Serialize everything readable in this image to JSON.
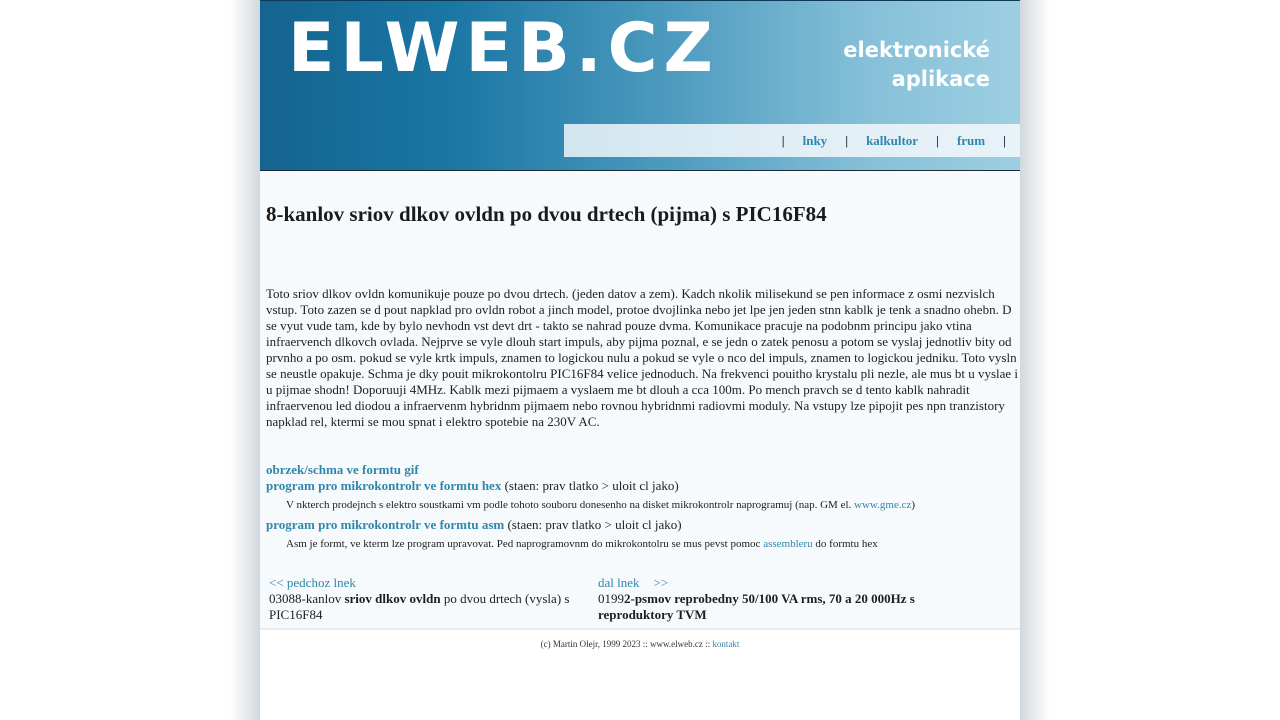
{
  "header": {
    "logo": "ELWEB.CZ",
    "tagline_line1": "elektronické",
    "tagline_line2": "aplikace"
  },
  "nav": {
    "separator": "|",
    "items": [
      {
        "label": "lnky"
      },
      {
        "label": "kalkultor"
      },
      {
        "label": "frum"
      }
    ]
  },
  "article": {
    "title": "8-kanlov sriov dlkov ovldn po dvou drtech (pijma) s PIC16F84",
    "body": "Toto sriov dlkov ovldn komunikuje pouze po dvou drtech. (jeden datov a zem). Kadch nkolik milisekund se pen informace z osmi nezvislch vstup. Toto zazen se d pout napklad pro ovldn robot a jinch model, protoe dvojlinka nebo jet lpe jen jeden stnn kablk je tenk a snadno ohebn. D se vyut vude tam, kde by bylo nevhodn vst devt drt - takto se nahrad pouze dvma. Komunikace pracuje na podobnm principu jako vtina infraervench dlkovch ovlada. Nejprve se vyle dlouh start impuls, aby pijma poznal, e se jedn o zatek penosu a potom se vyslaj jednotliv bity od prvnho a po osm. pokud se vyle krtk impuls, znamen to logickou nulu a pokud se vyle o nco del impuls, znamen to logickou jedniku. Toto vysln se neustle opakuje. Schma je dky pouit mikrokontolru PIC16F84 velice jednoduch. Na frekvenci pouitho krystalu pli nezle, ale mus bt u vyslae i u pijmae shodn! Doporuuji 4MHz. Kablk mezi pijmaem a vyslaem me bt dlouh a cca 100m. Po mench pravch se d tento kablk nahradit infraervenou led diodou a infraervenm hybridnm pijmaem nebo rovnou hybridnmi radiovmi moduly. Na vstupy lze pipojit pes npn tranzistory napklad rel, ktermi se mou spnat i elektro spotebie na 230V AC."
  },
  "downloads": {
    "gif_link": "obrzek/schma ve formtu gif",
    "hex_link": "program pro mikrokontrolr ve formtu hex",
    "hex_note": "(staen: prav tlatko > uloit cl jako)",
    "hex_small_text": "V nkterch prodejnch s elektro soustkami vm podle tohoto souboru donesenho na disket mikrokontrolr naprogramuj (nap. GM el. ",
    "hex_small_link": "www.gme.cz",
    "hex_small_end": ")",
    "asm_link": "program pro mikrokontrolr ve formtu asm",
    "asm_note": "(staen: prav tlatko > uloit cl jako)",
    "asm_small_text": "Asm je formt, ve kterm lze program upravovat. Ped naprogramovnm do mikrokontolru se mus pevst pomoc ",
    "asm_small_link": "assembleru",
    "asm_small_end": " do formtu hex"
  },
  "prev": {
    "link": "<< pedchoz lnek",
    "number": "0308",
    "text_start": "8-kanlov ",
    "text_bold": "sriov dlkov ovldn",
    "text_end": " po dvou drtech (vysla) s PIC16F84"
  },
  "next": {
    "link": "dal lnek",
    "arrow": ">>",
    "number": "0199",
    "text_bold": "2-psmov reprobedny 50/100 VA rms, 70 a 20 000Hz s reproduktory TVM"
  },
  "footer": {
    "text": "(c) Martin Olejr, 1999 2023 :: www.elweb.cz :: ",
    "link": "kontakt"
  }
}
